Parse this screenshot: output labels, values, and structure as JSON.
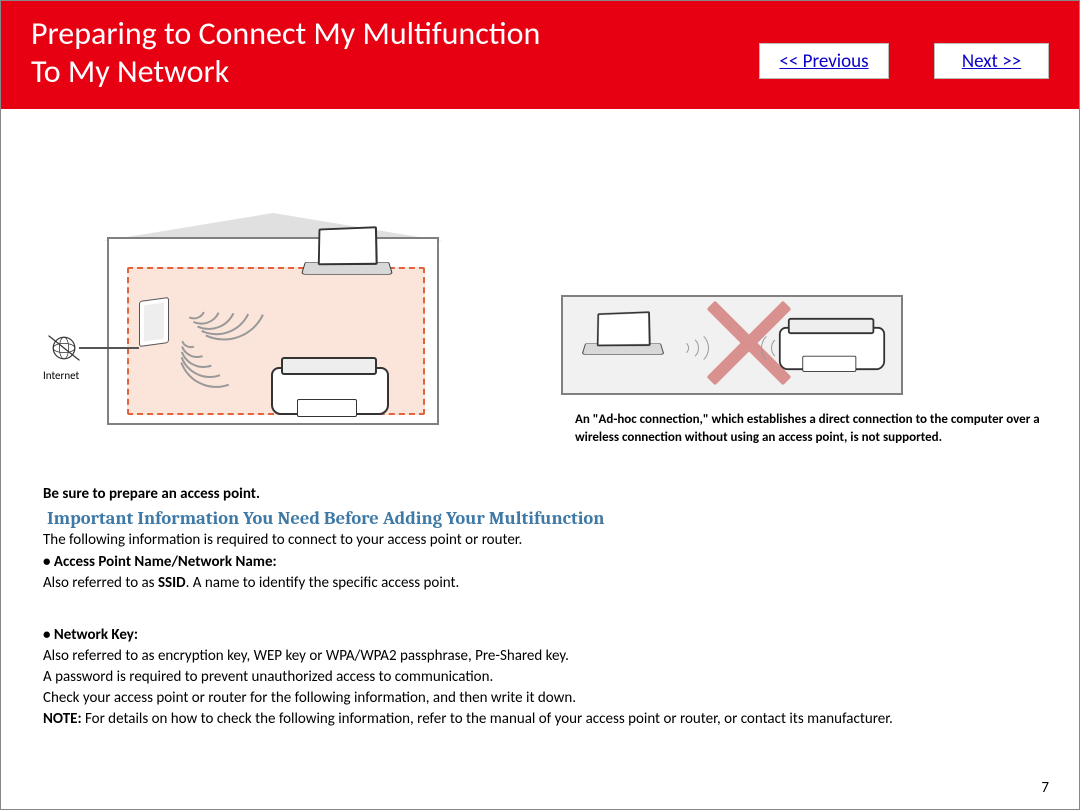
{
  "header": {
    "title_line1": "Preparing to Connect My Multifunction",
    "title_line2": "To My Network",
    "prev_label": "<< Previous",
    "next_label": "Next >>"
  },
  "diagram1": {
    "internet_label": "Internet"
  },
  "adhoc_note": "An \"Ad-hoc connection,\" which establishes a direct connection to the computer over a wireless connection without using an access point, is not supported.",
  "prep_line": "Be sure to prepare an access point.",
  "info_heading": "Important Information You Need Before Adding Your Multifunction",
  "body": {
    "intro": "The following information is required to connect to your access point or router.",
    "item1_label": "•  Access Point Name/Network Name:",
    "item1_text_a": "Also referred to as ",
    "item1_text_b": "SSID",
    "item1_text_c": ". A name to identify the specific access point.",
    "item2_label": "•  Network Key:",
    "item2_text1": "Also referred to as encryption key, WEP key or WPA/WPA2 passphrase, Pre-Shared key.",
    "item2_text2": "A password is required to prevent unauthorized access to communication.",
    "check_line": "Check your access point or router for the following information, and then write it down.",
    "note_prefix": "NOTE:",
    "note_text": "  For details on how to check the following information, refer to the manual of your access point or router, or contact its manufacturer."
  },
  "page_number": "7"
}
